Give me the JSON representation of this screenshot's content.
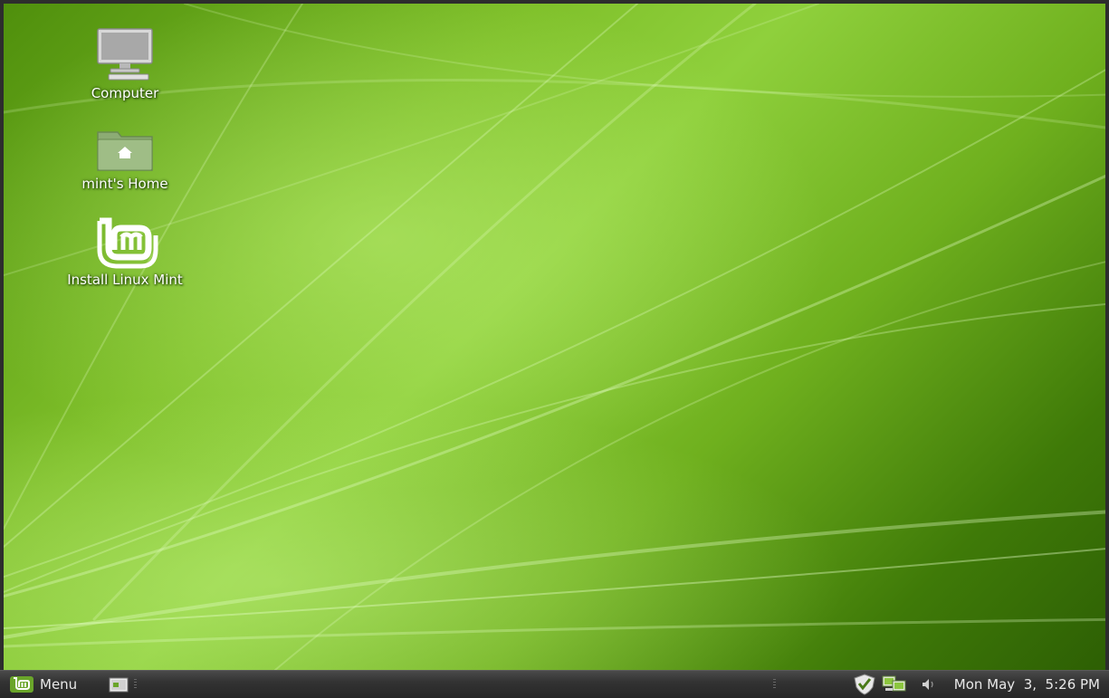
{
  "desktop": {
    "icons": [
      {
        "label": "Computer",
        "icon": "computer-icon"
      },
      {
        "label": "mint's Home",
        "icon": "home-folder-icon"
      },
      {
        "label": "Install Linux Mint",
        "icon": "linux-mint-logo-icon"
      }
    ]
  },
  "taskbar": {
    "menu_label": "Menu",
    "menu_icon": "linux-mint-logo-icon",
    "show_desktop_icon": "show-desktop-icon",
    "tray_icons": [
      "update-manager-shield-icon",
      "network-icon",
      "volume-icon"
    ],
    "clock": "Mon May  3,  5:26 PM"
  },
  "colors": {
    "wallpaper_green": "#7fc02a",
    "panel_dark": "#333333",
    "mint_green": "#8cc63e"
  }
}
